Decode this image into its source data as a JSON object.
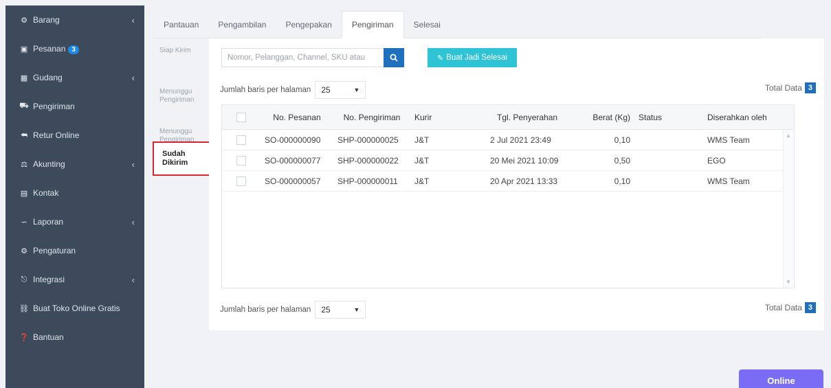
{
  "sidebar": {
    "items": [
      {
        "label": "Barang",
        "icon": "boxes-icon",
        "chevron": "‹"
      },
      {
        "label": "Pesanan",
        "icon": "cart-icon",
        "badge": "3"
      },
      {
        "label": "Gudang",
        "icon": "building-icon",
        "chevron": "‹"
      },
      {
        "label": "Pengiriman",
        "icon": "truck-icon"
      },
      {
        "label": "Retur Online",
        "icon": "reply-icon"
      },
      {
        "label": "Akunting",
        "icon": "scale-icon",
        "chevron": "‹"
      },
      {
        "label": "Kontak",
        "icon": "address-card-icon"
      },
      {
        "label": "Laporan",
        "icon": "chart-icon",
        "chevron": "‹"
      },
      {
        "label": "Pengaturan",
        "icon": "gears-icon"
      },
      {
        "label": "Integrasi",
        "icon": "sitemap-icon",
        "chevron": "‹"
      },
      {
        "label": "Buat Toko Online Gratis",
        "icon": "store-icon"
      },
      {
        "label": "Bantuan",
        "icon": "question-icon"
      }
    ]
  },
  "tabs": [
    "Pantauan",
    "Pengambilan",
    "Pengepakan",
    "Pengiriman",
    "Selesai"
  ],
  "active_tab": "Pengiriman",
  "subnav": {
    "items": [
      "Siap Kirim",
      "Menunggu Pengiriman",
      "Menunggu Pengiriman (Kurir Instant)"
    ],
    "active": "Sudah Dikirim"
  },
  "search": {
    "placeholder": "Nomor, Pelanggan, Channel, SKU atau"
  },
  "finish_button": "Buat Jadi Selesai",
  "pagination": {
    "rows_label": "Jumlah baris per halaman",
    "rows_value": "25",
    "total_label": "Total Data",
    "total_value": "3"
  },
  "table": {
    "columns": [
      "No. Pesanan",
      "No. Pengiriman",
      "Kurir",
      "Tgl. Penyerahan",
      "Berat (Kg)",
      "Status",
      "Diserahkan oleh"
    ],
    "rows": [
      {
        "pesanan": "SO-000000090",
        "pengiriman": "SHP-000000025",
        "kurir": "J&T",
        "tgl": "2 Jul 2021 23:49",
        "berat": "0,10",
        "status": "",
        "oleh": "WMS Team"
      },
      {
        "pesanan": "SO-000000077",
        "pengiriman": "SHP-000000022",
        "kurir": "J&T",
        "tgl": "20 Mei 2021 10:09",
        "berat": "0,50",
        "status": "",
        "oleh": "EGO"
      },
      {
        "pesanan": "SO-000000057",
        "pengiriman": "SHP-000000011",
        "kurir": "J&T",
        "tgl": "20 Apr 2021 13:33",
        "berat": "0,10",
        "status": "",
        "oleh": "WMS Team"
      }
    ]
  },
  "online_button": "Online",
  "colors": {
    "sidebar": "#3d4a5c",
    "primary": "#1f6fbf",
    "cyan": "#2ec4d6",
    "highlight": "#d7262d",
    "online": "#7b6cf5"
  }
}
